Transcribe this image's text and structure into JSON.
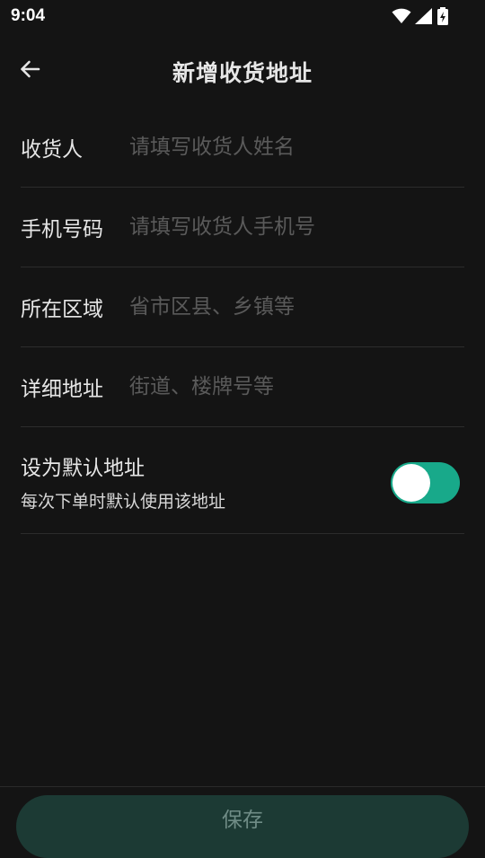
{
  "status_bar": {
    "time": "9:04",
    "icons": [
      "wifi-icon",
      "signal-icon",
      "battery-charging-icon"
    ]
  },
  "header": {
    "title": "新增收货地址",
    "back_icon": "back-arrow-icon"
  },
  "form": {
    "recipient": {
      "label": "收货人",
      "placeholder": "请填写收货人姓名",
      "value": ""
    },
    "phone": {
      "label": "手机号码",
      "placeholder": "请填写收货人手机号",
      "value": ""
    },
    "region": {
      "label": "所在区域",
      "placeholder": "省市区县、乡镇等",
      "value": ""
    },
    "detail": {
      "label": "详细地址",
      "placeholder": "街道、楼牌号等",
      "value": ""
    }
  },
  "default_address": {
    "title": "设为默认地址",
    "subtitle": "每次下单时默认使用该地址",
    "enabled": true
  },
  "footer": {
    "save_label": "保存"
  },
  "colors": {
    "background": "#141414",
    "accent": "#18a98a",
    "save_button_bg": "#1c3a34"
  }
}
